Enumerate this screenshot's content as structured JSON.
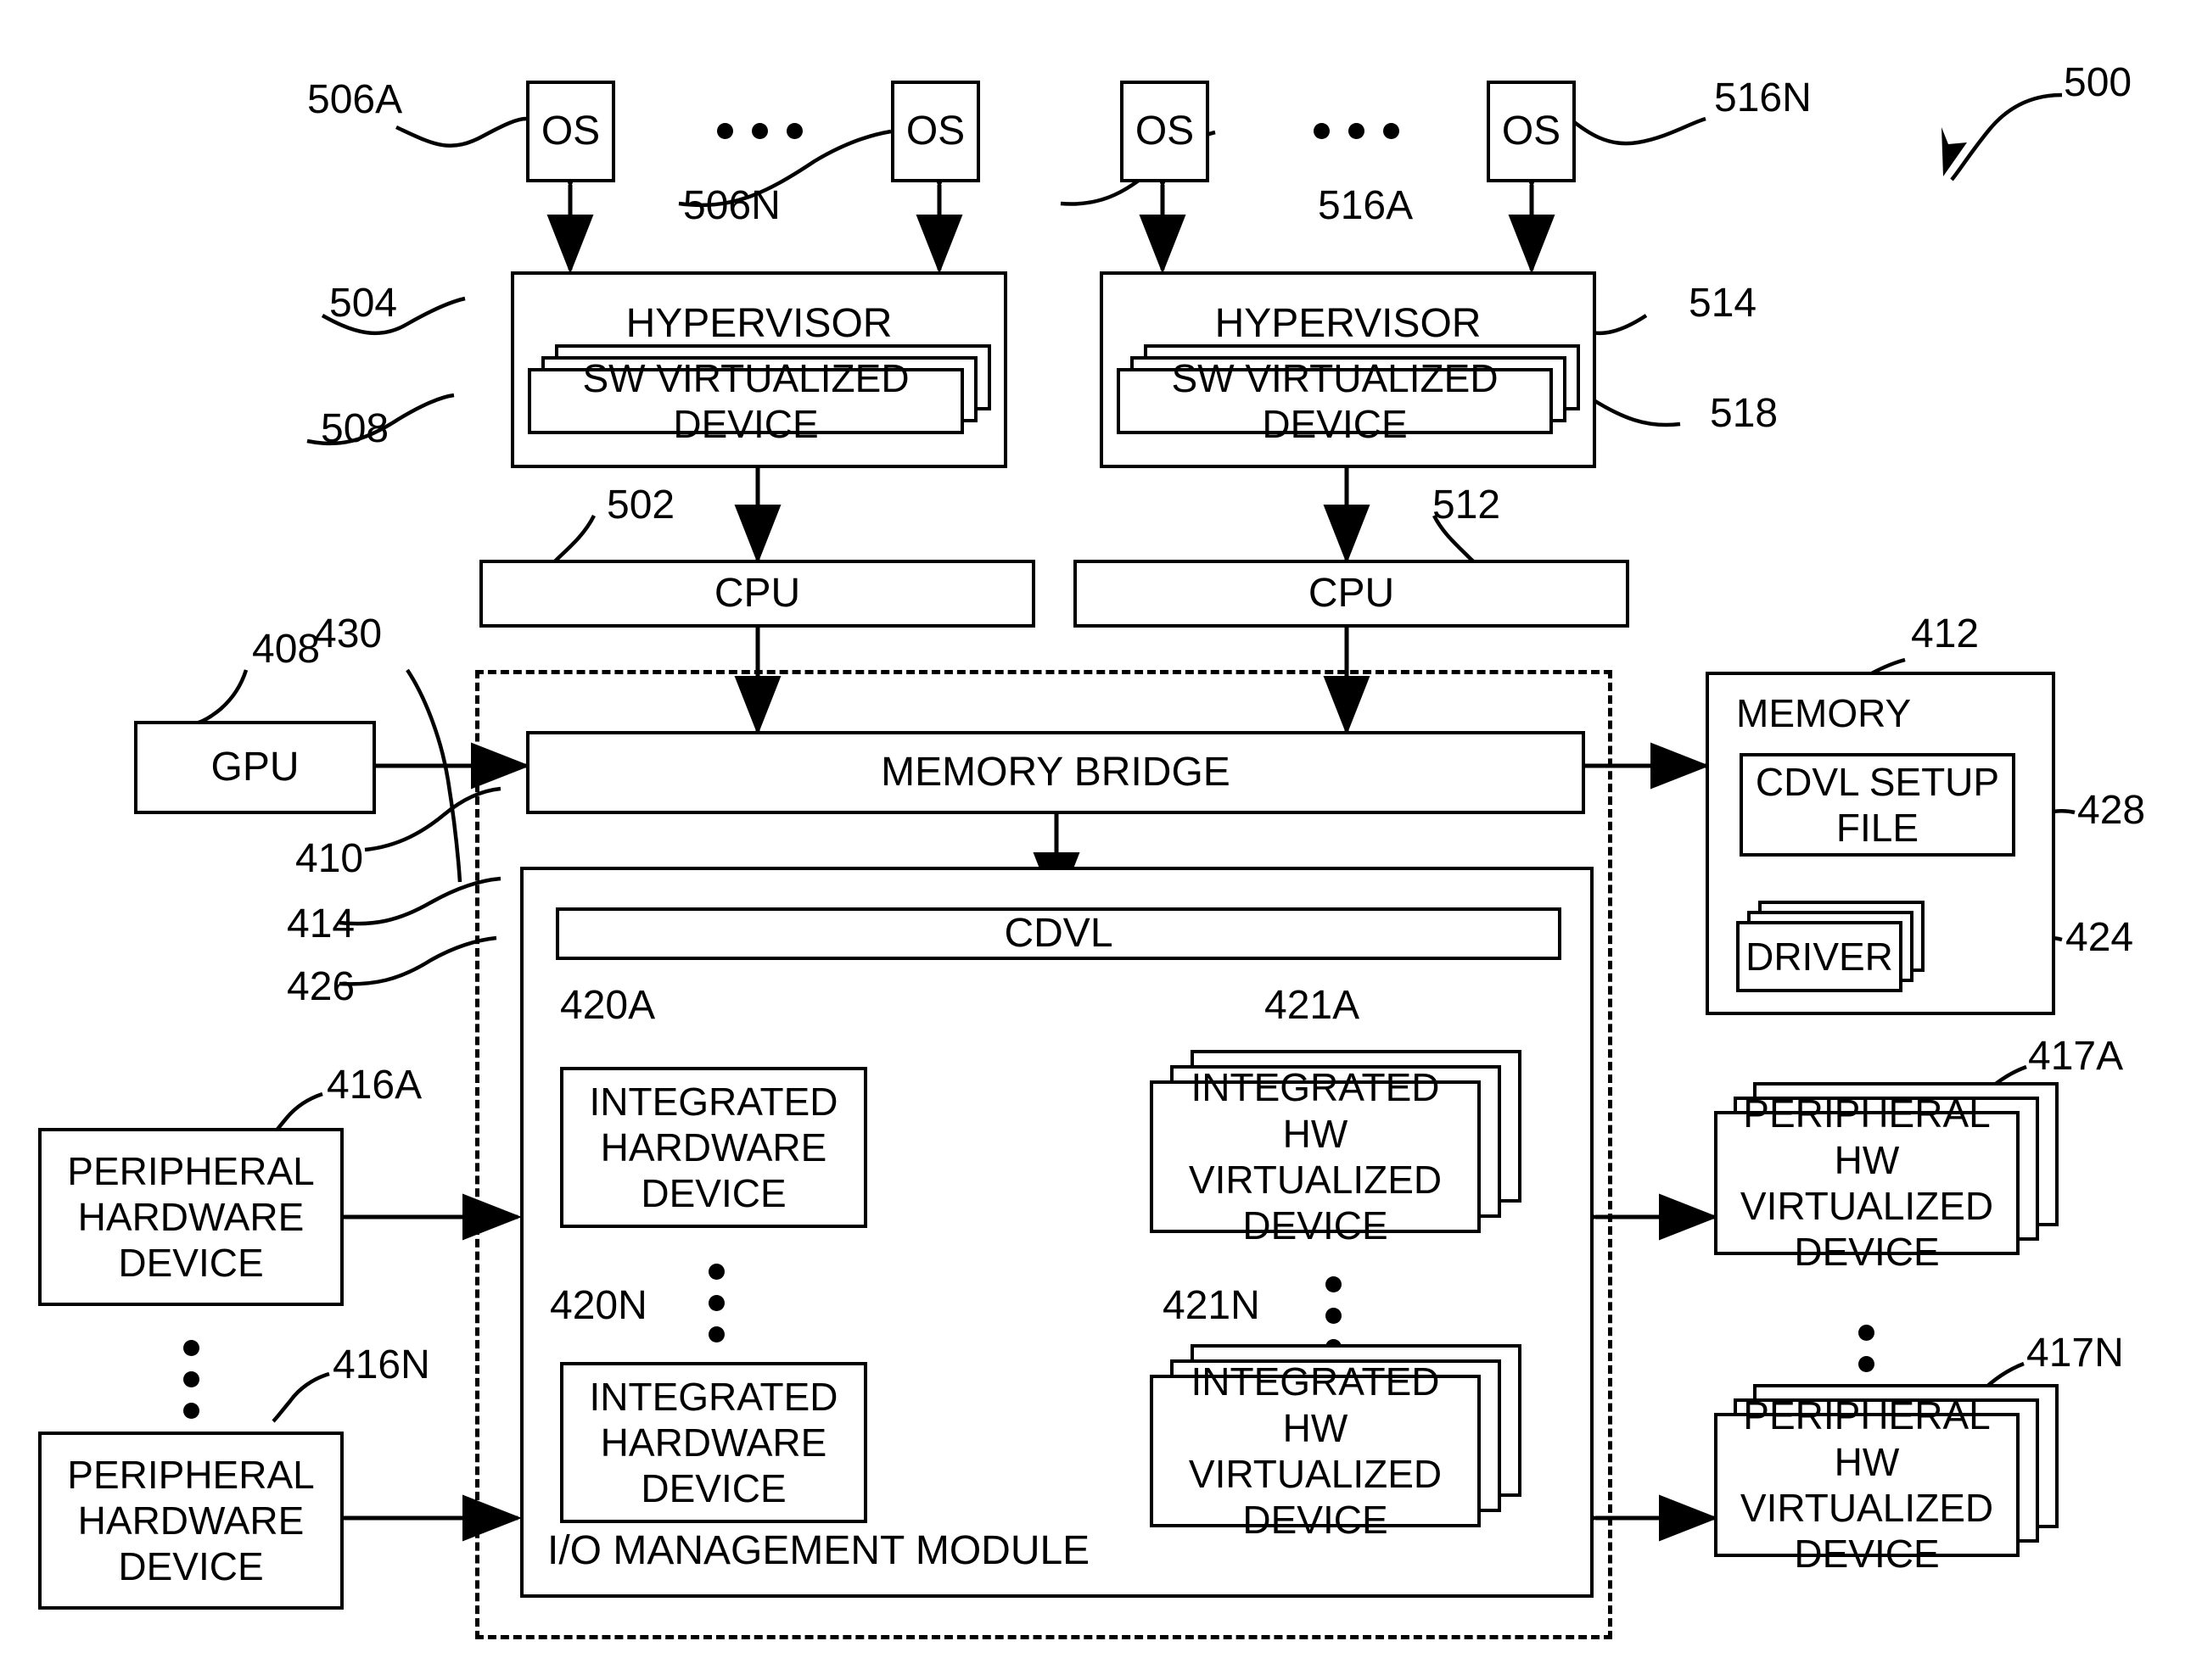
{
  "figure": {
    "number": "500",
    "title_ref": "500"
  },
  "nodes": {
    "os_1": {
      "label": "OS",
      "ref": "506A"
    },
    "os_2": {
      "label": "OS",
      "ref": "506N"
    },
    "os_3": {
      "label": "OS",
      "ref": "516A"
    },
    "os_4": {
      "label": "OS",
      "ref": "516N"
    },
    "hypervisor_left": {
      "label": "HYPERVISOR",
      "ref": "504"
    },
    "hypervisor_right": {
      "label": "HYPERVISOR",
      "ref": "514"
    },
    "sw_virt_left": {
      "label": "SW VIRTUALIZED DEVICE",
      "ref": "508"
    },
    "sw_virt_right": {
      "label": "SW VIRTUALIZED DEVICE",
      "ref": "518"
    },
    "cpu_left": {
      "label": "CPU",
      "ref": "502"
    },
    "cpu_right": {
      "label": "CPU",
      "ref": "512"
    },
    "gpu": {
      "label": "GPU",
      "ref": "408"
    },
    "memory_bridge": {
      "label": "MEMORY BRIDGE",
      "ref": "410"
    },
    "chipset_boundary": {
      "ref": "430"
    },
    "memory": {
      "label": "MEMORY",
      "ref": "412"
    },
    "cdvl_setup_file": {
      "label": "CDVL SETUP FILE",
      "ref": "428"
    },
    "driver": {
      "label": "DRIVER",
      "ref": "424"
    },
    "io_management_module": {
      "label": "I/O MANAGEMENT MODULE",
      "ref": "414"
    },
    "cdvl": {
      "label": "CDVL",
      "ref": "426"
    },
    "integrated_hw_device_a": {
      "label": "INTEGRATED HARDWARE DEVICE",
      "ref": "420A"
    },
    "integrated_hw_device_n": {
      "label": "INTEGRATED HARDWARE DEVICE",
      "ref": "420N"
    },
    "integrated_hw_virt_device_a": {
      "label": "INTEGRATED HW VIRTUALIZED DEVICE",
      "ref": "421A"
    },
    "integrated_hw_virt_device_n": {
      "label": "INTEGRATED HW VIRTUALIZED DEVICE",
      "ref": "421N"
    },
    "peripheral_hw_device_a": {
      "label": "PERIPHERAL HARDWARE DEVICE",
      "ref": "416A"
    },
    "peripheral_hw_device_n": {
      "label": "PERIPHERAL HARDWARE DEVICE",
      "ref": "416N"
    },
    "peripheral_hw_virt_device_a": {
      "label": "PERIPHERAL HW VIRTUALIZED DEVICE",
      "ref": "417A"
    },
    "peripheral_hw_virt_device_n": {
      "label": "PERIPHERAL HW VIRTUALIZED DEVICE",
      "ref": "417N"
    }
  },
  "colors": {
    "stroke": "#000000",
    "background": "#ffffff"
  }
}
